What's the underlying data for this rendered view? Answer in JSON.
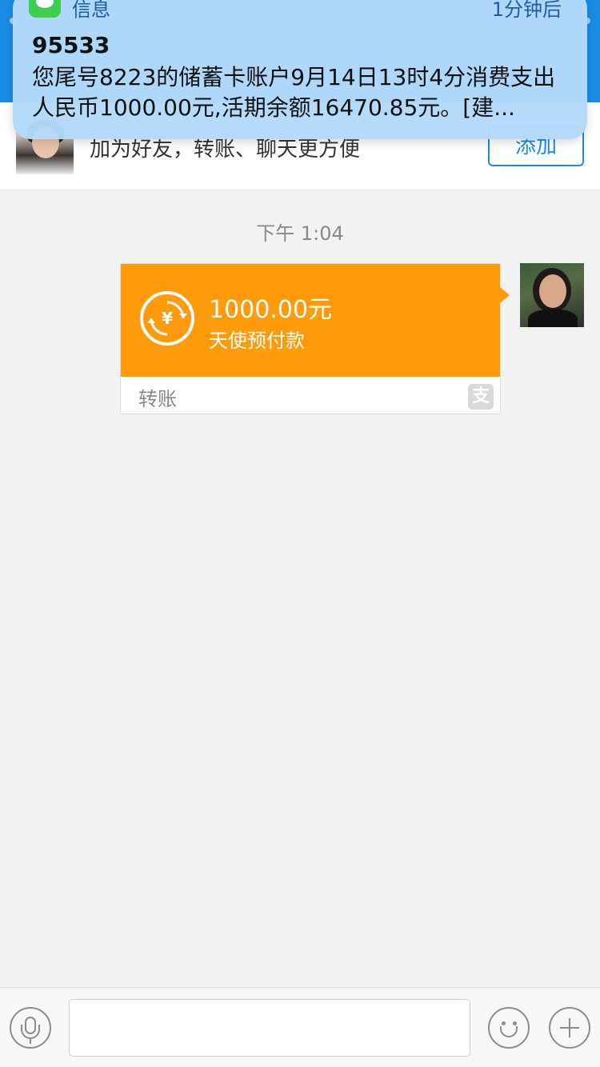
{
  "notification": {
    "app_name": "信息",
    "time": "1分钟后",
    "sender": "95533",
    "body": "您尾号8223的储蓄卡账户9月14日13时4分消费支出人民币1000.00元,活期余额16470.85元。[建..."
  },
  "friend_banner": {
    "text": "加为好友，转账、聊天更方便",
    "add_label": "添加"
  },
  "chat": {
    "timestamp": "下午 1:04",
    "transfer": {
      "amount": "1000.00元",
      "note": "天使预付款",
      "label": "转账",
      "brand_glyph": "支"
    }
  },
  "input_bar": {
    "placeholder": ""
  },
  "colors": {
    "accent": "#1a8ce6",
    "transfer_orange": "#ff9a0a"
  }
}
